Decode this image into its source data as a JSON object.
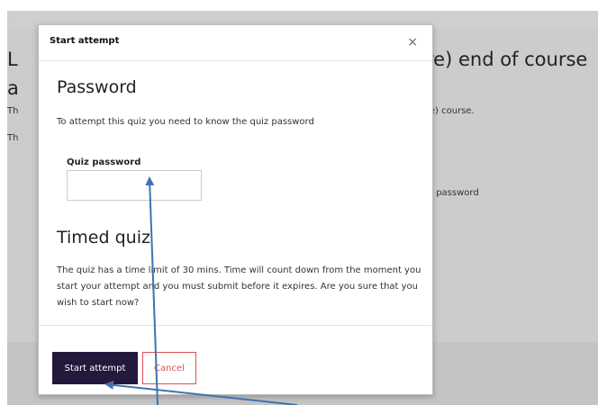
{
  "background": {
    "heading_left_1": "L",
    "heading_left_2": "a",
    "heading_right": "re) end of course",
    "text_left_1": "Th",
    "text_left_2": "Th",
    "text_right_1": "re) course.",
    "text_right_2": "iz password"
  },
  "modal": {
    "title": "Start attempt",
    "close_symbol": "×",
    "password_section": {
      "heading": "Password",
      "description": "To attempt this quiz you need to know the quiz password",
      "field_label": "Quiz password",
      "field_value": ""
    },
    "timed_section": {
      "heading": "Timed quiz",
      "description": "The quiz has a time limit of 30 mins. Time will count down from the moment you start your attempt and you must submit before it expires. Are you sure that you wish to start now?"
    },
    "footer": {
      "start_label": "Start attempt",
      "cancel_label": "Cancel"
    }
  },
  "colors": {
    "primary_button": "#23193c",
    "cancel_button": "#d9534f",
    "annotation_arrow": "#3e74b0"
  }
}
